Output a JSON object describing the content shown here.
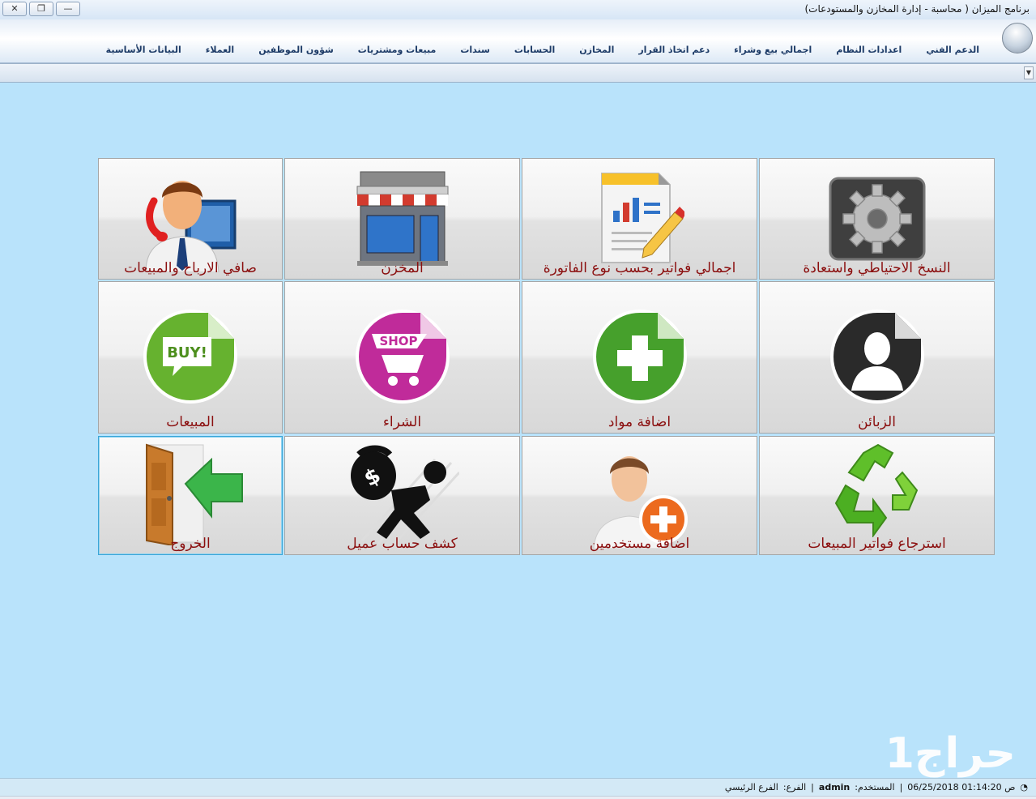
{
  "window": {
    "title": "برنامج الميزان ( محاسبة - إدارة المخازن والمستودعات)",
    "close": "✕",
    "restore": "❐",
    "minimize": "—"
  },
  "menu": [
    "البيانات الأساسية",
    "العملاء",
    "شؤون الموظفين",
    "مبيعات ومشتريات",
    "سندات",
    "الحسابات",
    "المخازن",
    "دعم اتخاذ القرار",
    "اجمالي بيع وشراء",
    "اعدادات النظام",
    "الدعم الفني"
  ],
  "tiles": {
    "backup": "النسخ الاحتياطي واستعادة",
    "invoices_total": "اجمالي فواتير بحسب نوع الفاتورة",
    "store": "المخزن",
    "net_profit": "صافي الارباح والمبيعات",
    "customers": "الزبائن",
    "add_items": "اضافة مواد",
    "purchase": "الشراء",
    "sales": "المبيعات",
    "sales_return": "استرجاع فواتير المبيعات",
    "add_users": "اضافة مستخدمين",
    "customer_statement": "كشف حساب عميل",
    "exit": "الخروج",
    "buy_text": "BUY!",
    "shop_text": "SHOP"
  },
  "watermark": "حراج1",
  "status": {
    "time": "ص 01:14:20 06/25/2018",
    "sep1": "|",
    "user_label": "المستخدم:",
    "user": "admin",
    "sep2": "|",
    "branch_label": "الفرع:",
    "branch": "الفرع الرئيسي"
  }
}
